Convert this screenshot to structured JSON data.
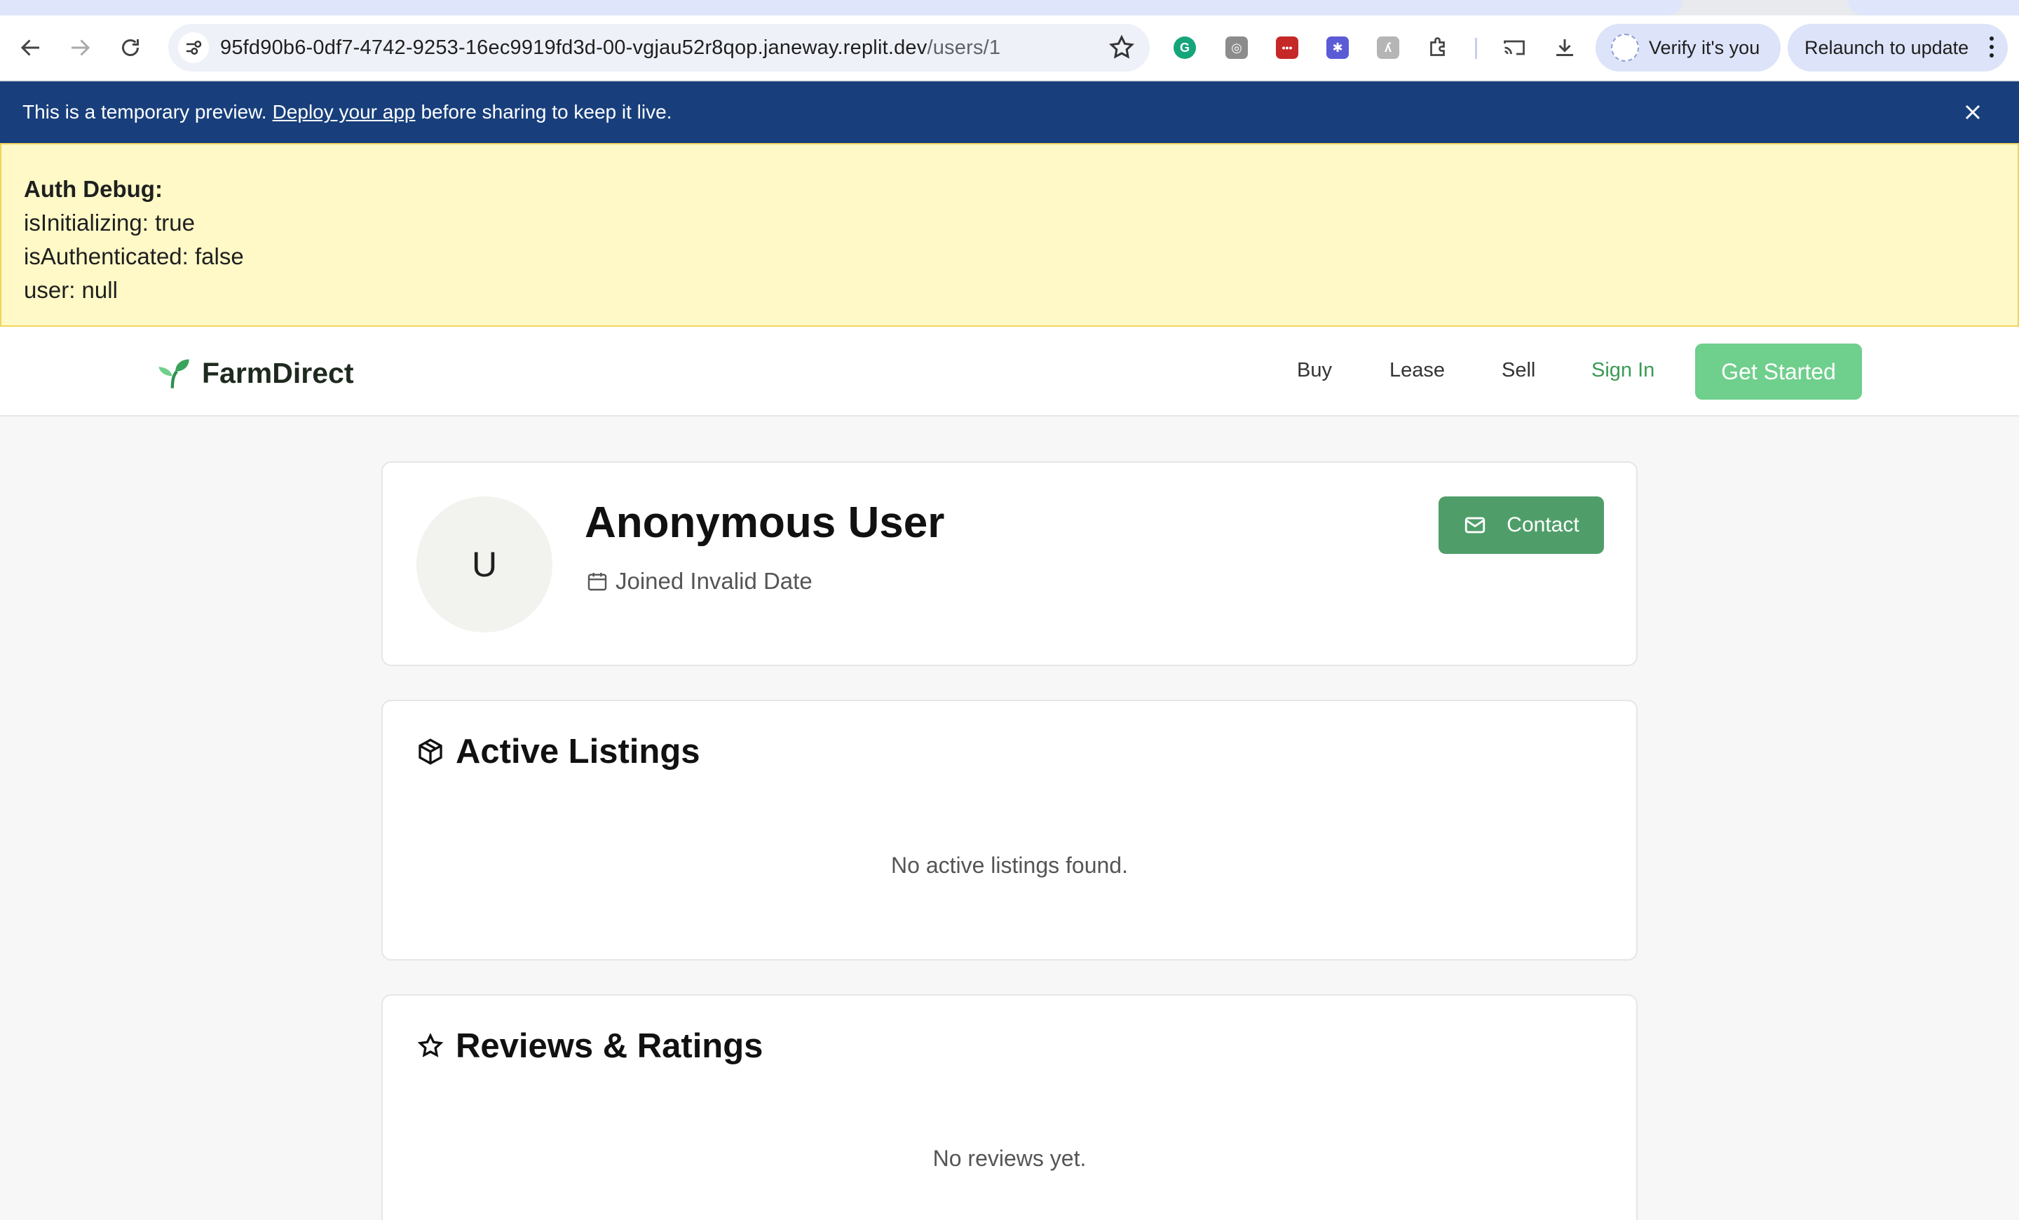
{
  "browser": {
    "url_host": "95fd90b6-0df7-4742-9253-16ec9919fd3d-00-vgjau52r8qop.janeway.replit.dev",
    "url_path": "/users/1",
    "verify_label": "Verify it's you",
    "relaunch_label": "Relaunch to update",
    "extensions": [
      {
        "name": "grammarly",
        "color": "#15a57a",
        "glyph": "G"
      },
      {
        "name": "ext-gray-1",
        "color": "#8c8c8c",
        "glyph": "◎"
      },
      {
        "name": "ext-red",
        "color": "#c62828",
        "glyph": "•••"
      },
      {
        "name": "ext-purple",
        "color": "#5b5bd6",
        "glyph": "✱"
      },
      {
        "name": "ext-gray-2",
        "color": "#b5b5b5",
        "glyph": "ʎ"
      }
    ]
  },
  "banner": {
    "prefix": "This is a temporary preview.",
    "link": "Deploy your app",
    "suffix": "before sharing to keep it live."
  },
  "debug": {
    "title": "Auth Debug:",
    "lines": [
      "isInitializing: true",
      "isAuthenticated: false",
      "user: null"
    ]
  },
  "header": {
    "brand": "FarmDirect",
    "nav": [
      "Buy",
      "Lease",
      "Sell"
    ],
    "sign_in": "Sign In",
    "get_started": "Get Started"
  },
  "profile": {
    "avatar_initial": "U",
    "name": "Anonymous User",
    "joined": "Joined Invalid Date",
    "contact": "Contact"
  },
  "listings": {
    "title": "Active Listings",
    "empty": "No active listings found."
  },
  "reviews": {
    "title": "Reviews & Ratings",
    "empty": "No reviews yet."
  },
  "colors": {
    "banner_bg": "#183f7c",
    "debug_bg": "#fef9c7",
    "brand_green": "#4f9e69",
    "cta_green": "#6fcf8c"
  }
}
